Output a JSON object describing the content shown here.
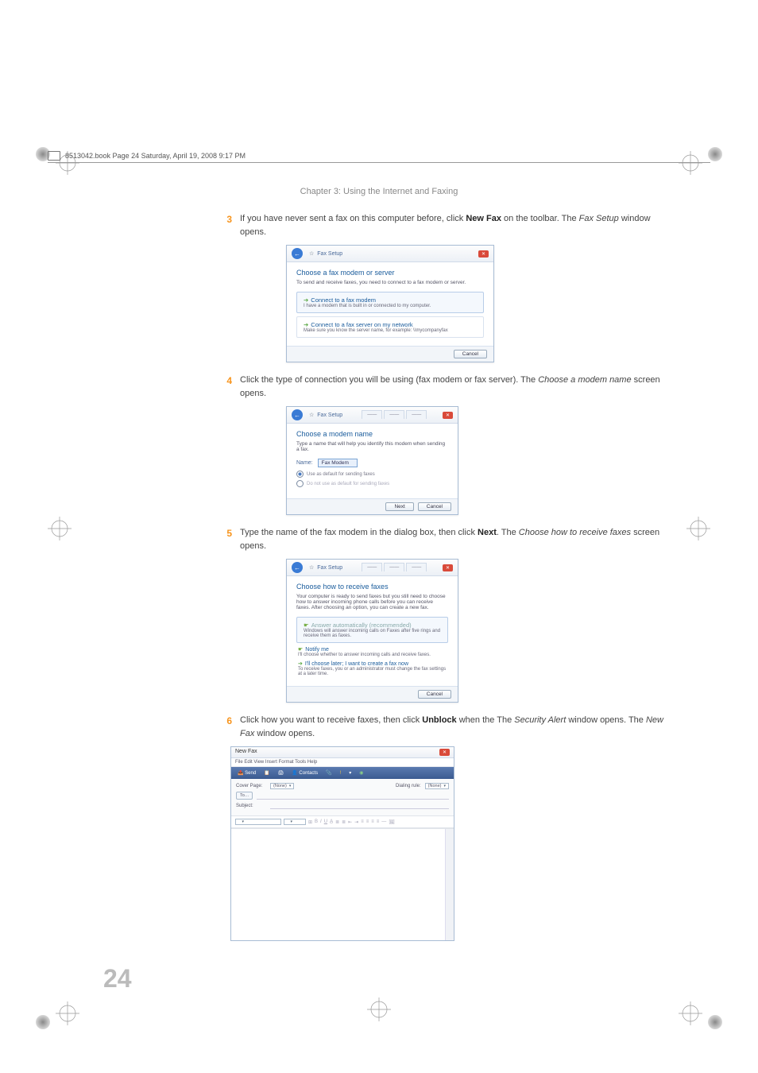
{
  "header": "8513042.book  Page 24  Saturday, April 19, 2008  9:17 PM",
  "chapter": "Chapter 3: Using the Internet and Faxing",
  "steps": {
    "s3": {
      "num": "3",
      "t1": "If you have never sent a fax on this computer before, click ",
      "b1": "New Fax",
      "t2": " on the toolbar. The ",
      "i1": "Fax Setup",
      "t3": " window opens."
    },
    "s4": {
      "num": "4",
      "t1": "Click the type of connection you will be using (fax modem or fax server). The ",
      "i1": "Choose a modem name",
      "t2": " screen opens."
    },
    "s5": {
      "num": "5",
      "t1": "Type the name of the fax modem in the dialog box, then click ",
      "b1": "Next",
      "t2": ". The ",
      "i1": "Choose how to receive faxes",
      "t3": " screen opens."
    },
    "s6": {
      "num": "6",
      "t1": "Click how you want to receive faxes, then click ",
      "b1": "Unblock",
      "t2": " when the The ",
      "i1": "Security Alert",
      "t3": " window opens. The ",
      "i2": "New Fax",
      "t4": " window opens."
    }
  },
  "win1": {
    "title": "Fax Setup",
    "heading": "Choose a fax modem or server",
    "sub": "To send and receive faxes, you need to connect to a fax modem or server.",
    "opt1t": "Connect to a fax modem",
    "opt1d": "I have a modem that is built in or connected to my computer.",
    "opt2t": "Connect to a fax server on my network",
    "opt2d": "Make sure you know the server name, for example: \\\\mycompanyfax",
    "cancel": "Cancel"
  },
  "win2": {
    "title": "Fax Setup",
    "heading": "Choose a modem name",
    "sub": "Type a name that will help you identify this modem when sending a fax.",
    "name_lbl": "Name:",
    "name_val": "Fax Modem",
    "r1": "Use as default for sending faxes",
    "r2": "Do not use as default for sending faxes",
    "next": "Next",
    "cancel": "Cancel"
  },
  "win3": {
    "title": "Fax Setup",
    "heading": "Choose how to receive faxes",
    "sub": "Your computer is ready to send faxes but you still need to choose how to answer incoming phone calls before you can receive faxes. After choosing an option, you can create a new fax.",
    "opt1t": "Answer automatically (recommended)",
    "opt1d": "Windows will answer incoming calls on Faxes after five rings and receive them as faxes.",
    "opt2t": "Notify me",
    "opt2d": "I'll choose whether to answer incoming calls and receive faxes.",
    "opt3t": "I'll choose later; I want to create a fax now",
    "opt3d": "To receive faxes, you or an administrator must change the fax settings at a later time.",
    "cancel": "Cancel"
  },
  "newfax": {
    "title": "New Fax",
    "menu": "File   Edit   View   Insert   Format   Tools   Help",
    "send": "Send",
    "contacts": "Contacts",
    "cover_lbl": "Cover Page:",
    "cover_val": "(None)",
    "to_btn": "To…",
    "subject_lbl": "Subject:",
    "dialing_lbl": "Dialing rule:",
    "dialing_val": "(None)"
  },
  "pagenum": "24"
}
